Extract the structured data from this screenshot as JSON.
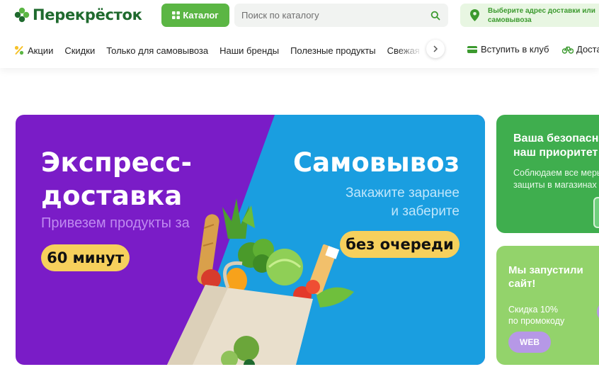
{
  "header": {
    "logo_text": "Перекрёсток",
    "catalog_label": "Каталог",
    "search_placeholder": "Поиск по каталогу",
    "address_text": "Выберите адрес доставки или самовывоза"
  },
  "nav": {
    "items": [
      {
        "label": "Акции",
        "icon": "percent-icon"
      },
      {
        "label": "Скидки"
      },
      {
        "label": "Только для самовывоза"
      },
      {
        "label": "Наши бренды"
      },
      {
        "label": "Полезные продукты"
      },
      {
        "label": "Свежая"
      }
    ],
    "club_label": "Вступить в клуб",
    "delivery_label": "Доставка"
  },
  "banner": {
    "left_title": [
      "Экспресс-",
      "доставка"
    ],
    "left_subtitle": "Привезем продукты за",
    "left_pill": "60 минут",
    "right_title": "Самовывоз",
    "right_subtitle": [
      "Закажите заранее",
      "и заберите"
    ],
    "right_pill": "без очереди"
  },
  "side_cards": {
    "card1": {
      "title": [
        "Ваша безопасность —",
        "наш приоритет"
      ],
      "text": [
        "Соблюдаем все меры",
        "защиты в магазинах"
      ]
    },
    "card2": {
      "title": [
        "Мы запустили",
        "сайт!"
      ],
      "text": [
        "Скидка 10%",
        "по промокоду"
      ],
      "button_label": "WEB"
    }
  },
  "colors": {
    "brand_green": "#1f6a2e",
    "accent_green": "#5bb644",
    "promo_purple": "#7a1cc7",
    "promo_blue": "#1a9ee0",
    "pill_yellow": "#f6d05c"
  }
}
